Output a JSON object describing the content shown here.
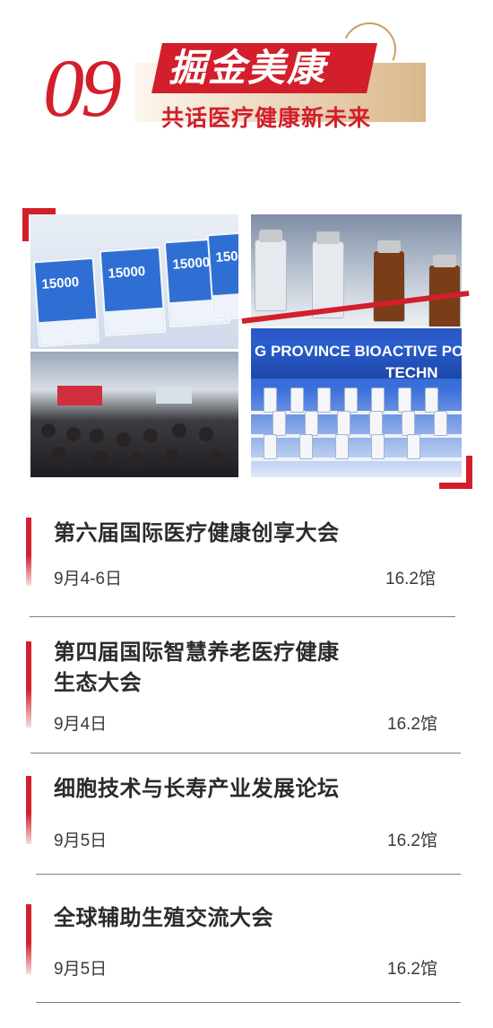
{
  "header": {
    "section_number": "09",
    "title": "掘金美康",
    "subtitle": "共话医疗健康新未来"
  },
  "photos": {
    "box_label": "15000",
    "booth_banner_line1": "G PROVINCE BIOACTIVE PO",
    "booth_banner_line2": "TECHN"
  },
  "events": [
    {
      "title": "第六届国际医疗健康创享大会",
      "date": "9月4-6日",
      "hall": "16.2馆"
    },
    {
      "title_line1": "第四届国际智慧养老医疗健康",
      "title_line2": "生态大会",
      "date": "9月4日",
      "hall": "16.2馆"
    },
    {
      "title": "细胞技术与长寿产业发展论坛",
      "date": "9月5日",
      "hall": "16.2馆"
    },
    {
      "title": "全球辅助生殖交流大会",
      "date": "9月5日",
      "hall": "16.2馆"
    }
  ],
  "colors": {
    "accent": "#d21f2b",
    "gold": "#c9a063",
    "text": "#2b2b2b"
  }
}
